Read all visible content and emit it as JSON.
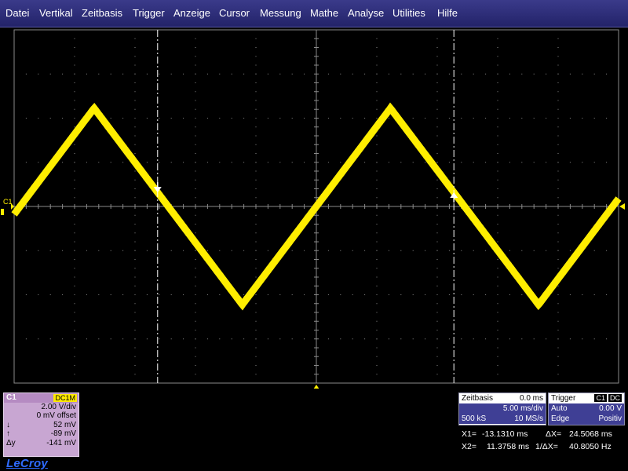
{
  "menu": {
    "items": [
      "Datei",
      "Vertikal",
      "Zeitbasis",
      "Trigger",
      "Anzeige",
      "Cursor",
      "Messung",
      "Mathe",
      "Analyse",
      "Utilities",
      "Hilfe"
    ]
  },
  "channel": {
    "label": "C1",
    "coupling": "DC1M",
    "vdiv": "2.00 V/div",
    "offset": "0 mV offset",
    "cursor_down_symbol": "↓",
    "cursor_down_value": "52 mV",
    "cursor_up_symbol": "↑",
    "cursor_up_value": "-89 mV",
    "delta_label": "Δy",
    "delta_value": "-141 mV",
    "trace_color": "#ffee00"
  },
  "logo": "LeCroy",
  "timebase": {
    "title": "Zeitbasis",
    "delay": "0.0 ms",
    "tdiv": "5.00 ms/div",
    "samples": "500 kS",
    "rate": "10 MS/s"
  },
  "trigger": {
    "title": "Trigger",
    "source": "C1",
    "coupling": "DC",
    "mode": "Auto",
    "level": "0.00 V",
    "type": "Edge",
    "slope": "Positiv"
  },
  "cursors": {
    "x1_label": "X1=",
    "x1_value": "-13.1310 ms",
    "dx_label": "ΔX=",
    "dx_value": "24.5068 ms",
    "x2_label": "X2=",
    "x2_value": "11.3758 ms",
    "inv_dx_label": "1/ΔX=",
    "inv_dx_value": "40.8050 Hz"
  },
  "waveform": {
    "type": "triangle",
    "frequency_hz": 40.8,
    "amplitude_v": 4.45,
    "phase_deg": 0,
    "time_per_div_ms": 5,
    "volts_per_div": 2,
    "h_divs": 10,
    "v_divs": 8
  },
  "colors": {
    "menu_bg": "#2c2c78",
    "grid": "#8a8a8a",
    "channel_panel": "#c8a6d2",
    "panel_blue": "#3f3f95",
    "logo": "#2f6bff"
  }
}
